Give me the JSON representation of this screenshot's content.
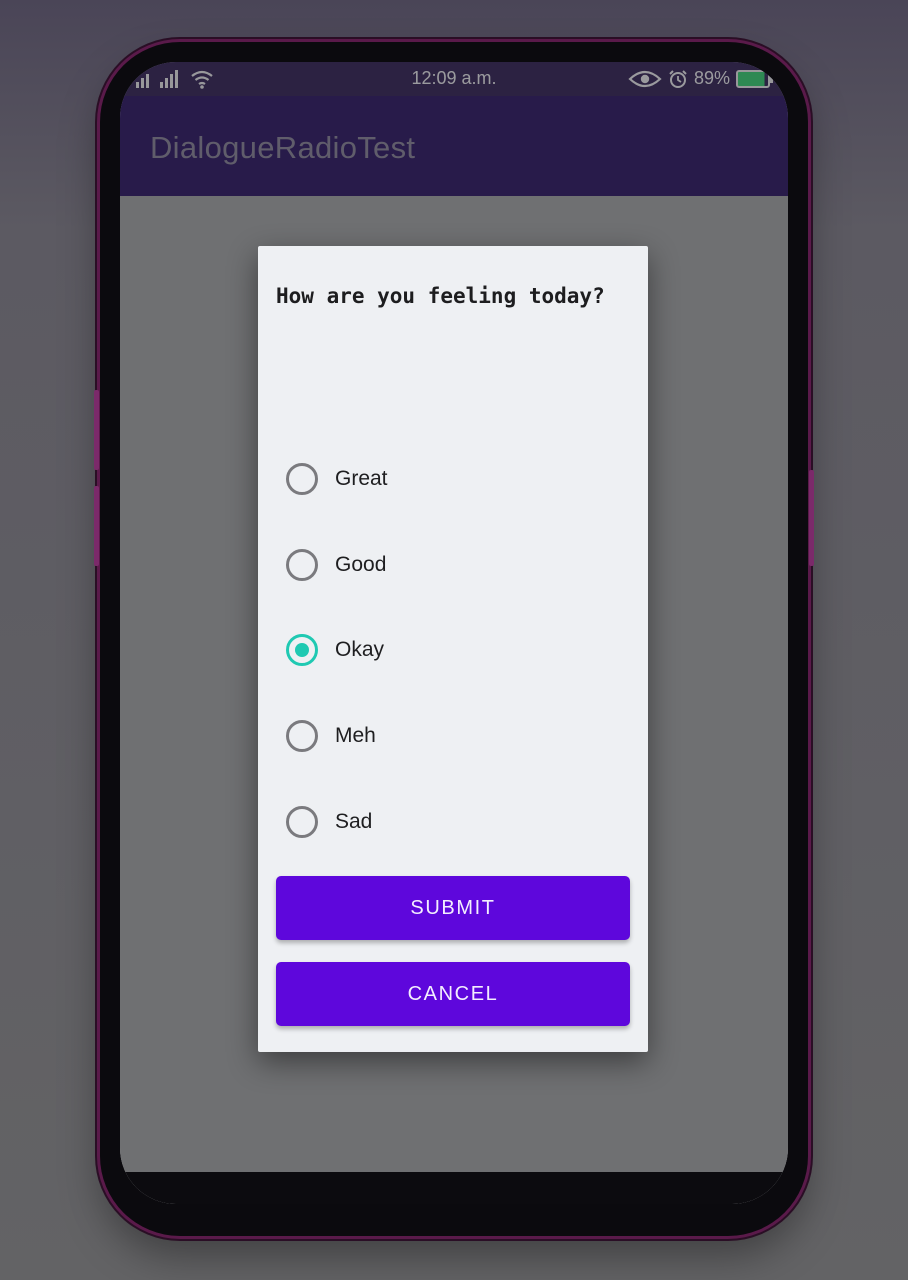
{
  "status_bar": {
    "time": "12:09 a.m.",
    "battery": "89%",
    "icons": [
      "signal-icon",
      "wifi-icon",
      "eye-icon",
      "alarm-icon",
      "battery-charging-icon"
    ]
  },
  "app_bar": {
    "title": "DialogueRadioTest"
  },
  "dialog": {
    "title": "How are you feeling today?",
    "options": [
      "Great",
      "Good",
      "Okay",
      "Meh",
      "Sad"
    ],
    "selected": "Okay",
    "submit_label": "SUBMIT",
    "cancel_label": "CANCEL"
  },
  "colors": {
    "app_bar": "#35206b",
    "accent_radio": "#1fc9b2",
    "button": "#5e07dc",
    "dialog_bg": "#eef0f3"
  }
}
